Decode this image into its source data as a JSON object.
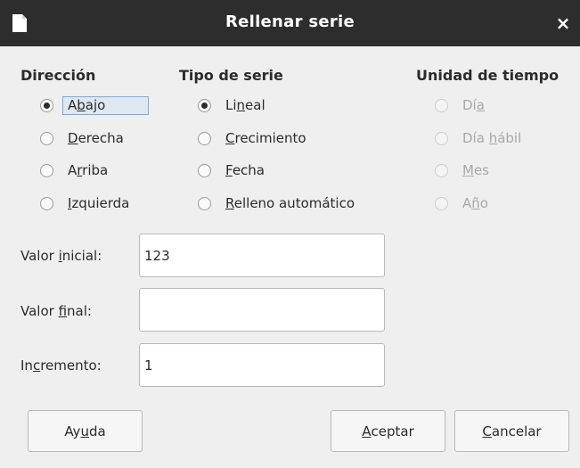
{
  "window": {
    "title": "Rellenar serie",
    "doc_icon": "document-icon",
    "close_icon": "×"
  },
  "direccion": {
    "heading": "Dirección",
    "options": [
      {
        "pre": "A",
        "u": "b",
        "post": "ajo",
        "checked": true
      },
      {
        "pre": "",
        "u": "D",
        "post": "erecha",
        "checked": false
      },
      {
        "pre": "A",
        "u": "r",
        "post": "riba",
        "checked": false
      },
      {
        "pre": "",
        "u": "I",
        "post": "zquierda",
        "checked": false
      }
    ]
  },
  "tipo_serie": {
    "heading": "Tipo de serie",
    "options": [
      {
        "pre": "Li",
        "u": "n",
        "post": "eal",
        "checked": true
      },
      {
        "pre": "",
        "u": "C",
        "post": "recimiento",
        "checked": false
      },
      {
        "pre": "",
        "u": "F",
        "post": "echa",
        "checked": false
      },
      {
        "pre": "",
        "u": "R",
        "post": "elleno automático",
        "checked": false
      }
    ]
  },
  "unidad_tiempo": {
    "heading": "Unidad de tiempo",
    "options": [
      {
        "pre": "Dí",
        "u": "a",
        "post": "",
        "checked": false,
        "disabled": true
      },
      {
        "pre": "Día ",
        "u": "h",
        "post": "ábil",
        "checked": false,
        "disabled": true
      },
      {
        "pre": "",
        "u": "M",
        "post": "es",
        "checked": false,
        "disabled": true
      },
      {
        "pre": "A",
        "u": "ñ",
        "post": "o",
        "checked": false,
        "disabled": true
      }
    ]
  },
  "fields": {
    "inicial": {
      "pre": "Valor ",
      "u": "i",
      "post": "nicial:",
      "value": "123"
    },
    "final": {
      "pre": "Valor ",
      "u": "f",
      "post": "inal:",
      "value": ""
    },
    "incremento": {
      "pre": "In",
      "u": "c",
      "post": "remento:",
      "value": "1"
    }
  },
  "buttons": {
    "ayuda": {
      "pre": "Ay",
      "u": "u",
      "post": "da"
    },
    "aceptar": {
      "pre": "",
      "u": "A",
      "post": "ceptar"
    },
    "cancelar": {
      "pre": "",
      "u": "C",
      "post": "ancelar"
    }
  }
}
